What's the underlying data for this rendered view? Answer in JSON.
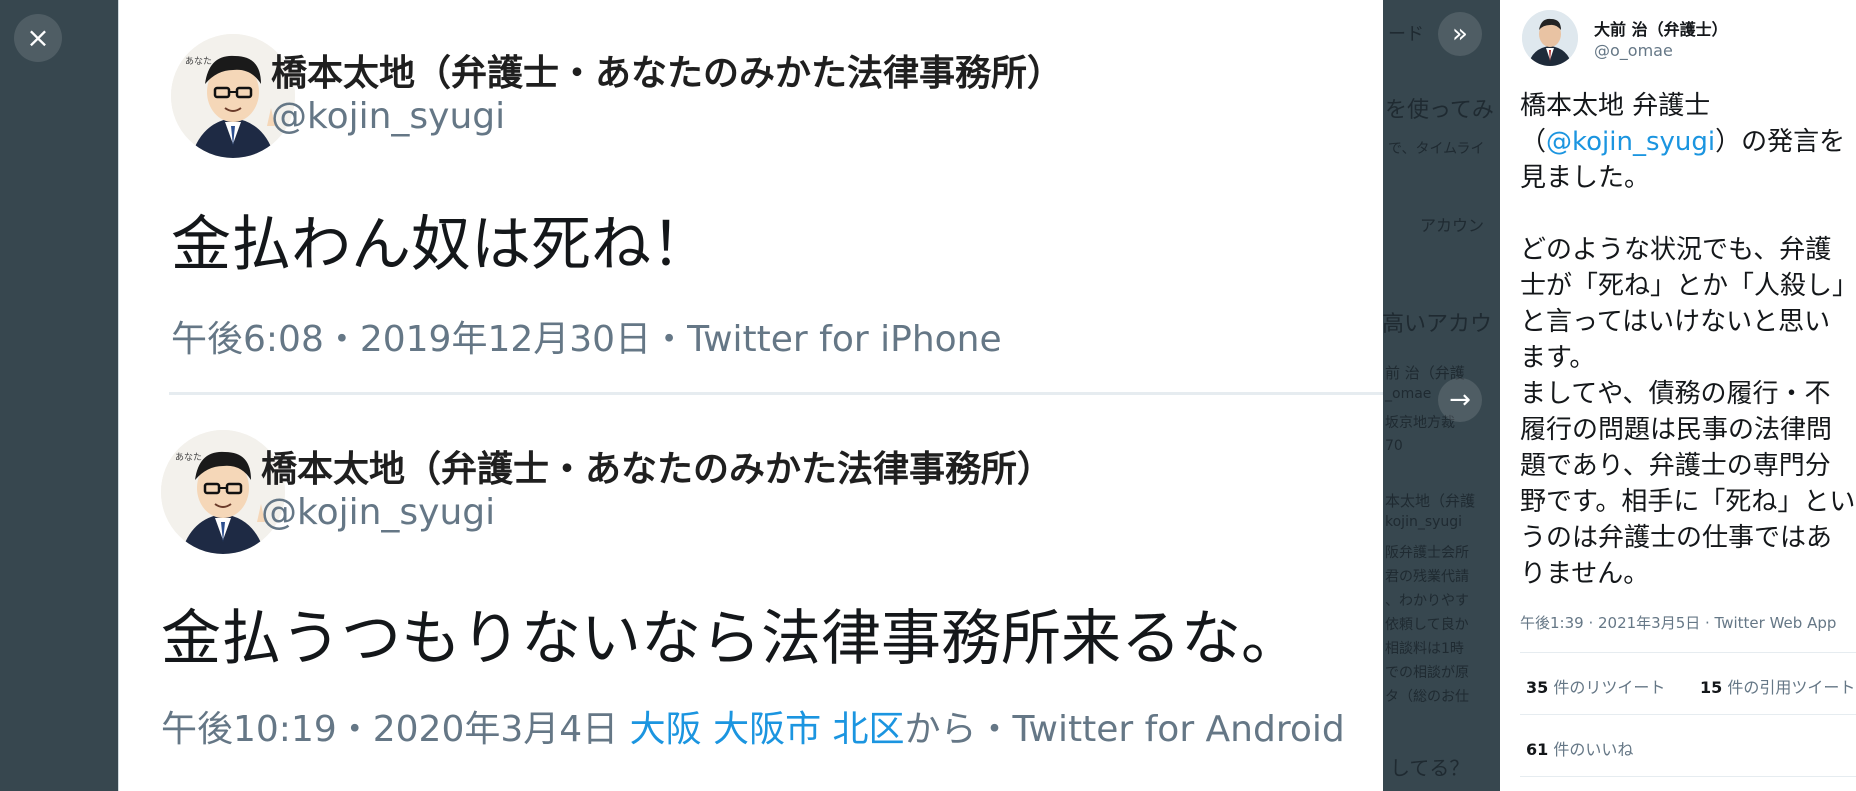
{
  "viewer": {
    "close_glyph": "×",
    "expand_glyph": "»",
    "next_glyph": "→"
  },
  "image_tweets": [
    {
      "name": "橋本太地（弁護士・あなたのみかた法律事務所）",
      "handle": "@kojin_syugi",
      "text": "金払わん奴は死ね！",
      "meta": "午後6:08・2019年12月30日・Twitter for iPhone"
    },
    {
      "name": "橋本太地（弁護士・あなたのみかた法律事務所）",
      "handle": "@kojin_syugi",
      "text": "金払うつもりないなら法律事務所来るな。",
      "meta_prefix": "午後10:19・2020年3月4日 ",
      "meta_location": "大阪 大阪市 北区",
      "meta_suffix": "から・Twitter for Android"
    }
  ],
  "sidebar": {
    "author_name": "大前 治（弁護士）",
    "author_handle": "@o_omae",
    "text_part1": "橋本太地 弁護士（",
    "mention": "@kojin_syugi",
    "text_part2": "）の発言を見ました。\n\nどのような状況でも、弁護士が「死ね」とか「人殺し」と言ってはいけないと思います。\nましてや、債務の履行・不履行の問題は民事の法律問題であり、弁護士の専門分野です。相手に「死ね」というのは弁護士の仕事ではありません。",
    "timestamp": "午後1:39 · 2021年3月5日 · Twitter Web App",
    "retweets_count": "35",
    "retweets_label": "件のリツイート",
    "quotes_count": "15",
    "quotes_label": "件の引用ツイート",
    "likes_count": "61",
    "likes_label": "件のいいね"
  },
  "background_fragments": {
    "f1": "ード",
    "f2": "を使ってみ",
    "f3": "で、タイムライ",
    "f4": "アカウン",
    "f5": "高いアカウ",
    "f6": "前 治（弁護",
    "f7": "_omae",
    "f8": "阪弁護士会所",
    "f9": "君の残業代請",
    "f10": "、わかりやす",
    "f11": "依頼して良か",
    "f12": "相談料は1時",
    "f13": "での相談が原",
    "f14": "タ（総のお仕",
    "f15": "してる？",
    "f16": "本太地（弁護",
    "f17": "kojin_syugi",
    "f18": "坂京地方裁",
    "f19": "70"
  }
}
